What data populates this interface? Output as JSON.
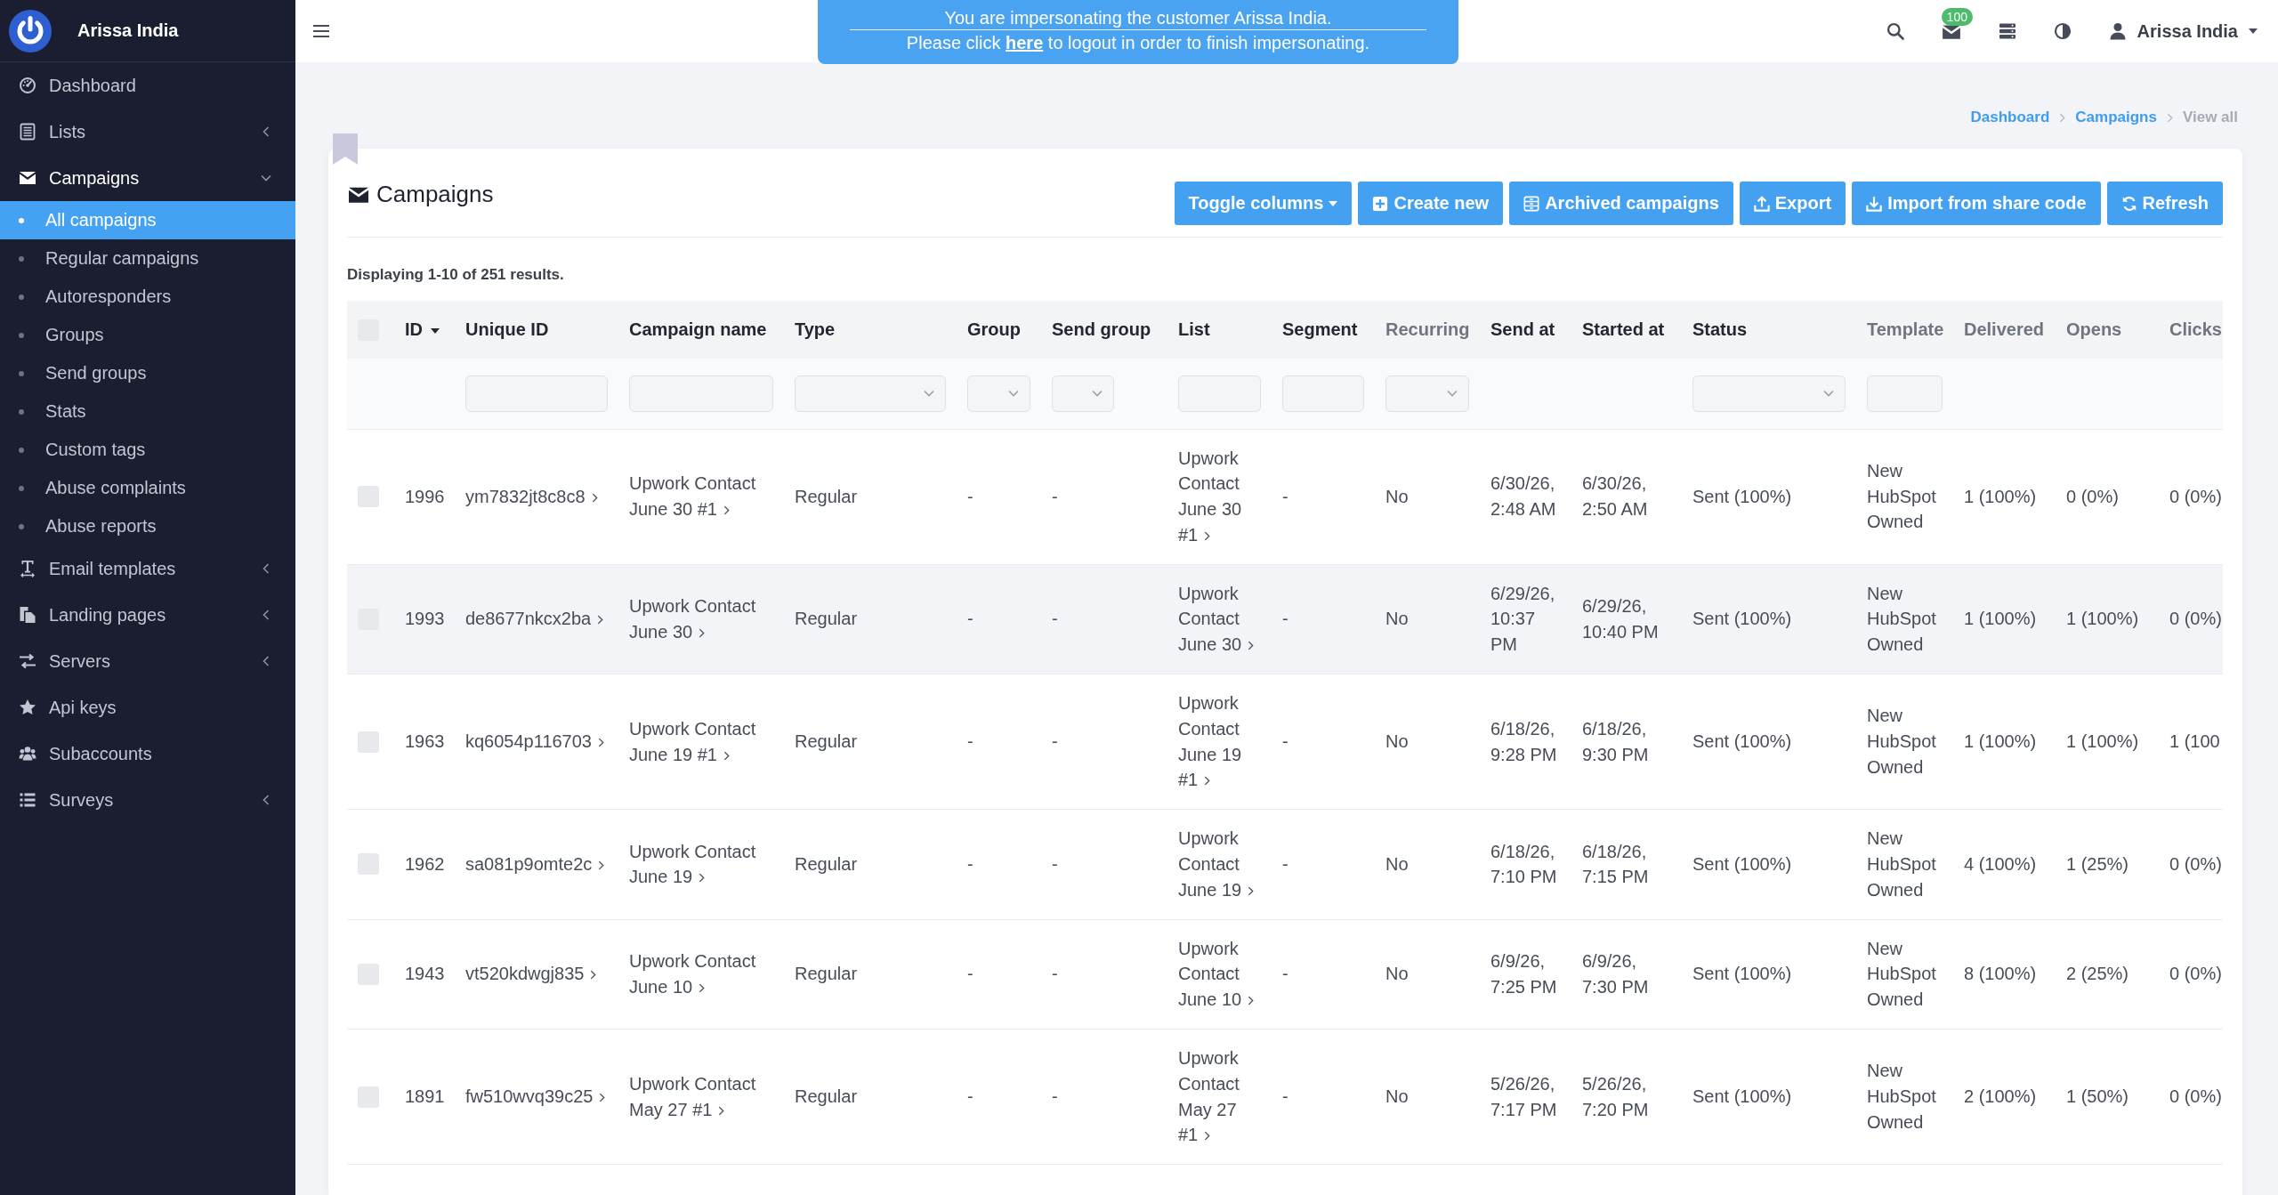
{
  "sidebar": {
    "brand": "Arissa India",
    "items": [
      {
        "kind": "link",
        "label": "Dashboard"
      },
      {
        "kind": "menu",
        "label": "Lists",
        "expanded": false
      },
      {
        "kind": "menu",
        "label": "Campaigns",
        "expanded": true,
        "children": [
          {
            "label": "All campaigns",
            "selected": true
          },
          {
            "label": "Regular campaigns",
            "selected": false
          },
          {
            "label": "Autoresponders",
            "selected": false
          },
          {
            "label": "Groups",
            "selected": false
          },
          {
            "label": "Send groups",
            "selected": false
          },
          {
            "label": "Stats",
            "selected": false
          },
          {
            "label": "Custom tags",
            "selected": false
          },
          {
            "label": "Abuse complaints",
            "selected": false
          },
          {
            "label": "Abuse reports",
            "selected": false
          }
        ]
      },
      {
        "kind": "menu",
        "label": "Email templates",
        "expanded": false
      },
      {
        "kind": "menu",
        "label": "Landing pages",
        "expanded": false
      },
      {
        "kind": "menu",
        "label": "Servers",
        "expanded": false
      },
      {
        "kind": "link",
        "label": "Api keys"
      },
      {
        "kind": "link",
        "label": "Subaccounts"
      },
      {
        "kind": "menu",
        "label": "Surveys",
        "expanded": false
      }
    ]
  },
  "topbar": {
    "impersonation_banner": {
      "line1": "You are impersonating the customer Arissa India.",
      "line2_before": "Please click",
      "link": "here",
      "line2_after": "to logout in order to finish impersonating."
    },
    "notifications_badge": "100",
    "user": "Arissa India"
  },
  "breadcrumb": [
    {
      "kind": "link",
      "label": "Dashboard"
    },
    {
      "kind": "link",
      "label": "Campaigns"
    },
    {
      "kind": "current",
      "label": "View all"
    }
  ],
  "card": {
    "title": "Campaigns",
    "buttons": [
      {
        "kind": "dropdown",
        "label": "Toggle columns"
      },
      {
        "kind": "action",
        "label": "Create new"
      },
      {
        "kind": "action",
        "label": "Archived campaigns"
      },
      {
        "kind": "action",
        "label": "Export"
      },
      {
        "kind": "action",
        "label": "Import from share code"
      },
      {
        "kind": "action",
        "label": "Refresh"
      }
    ],
    "summary": "Displaying 1-10 of 251 results."
  },
  "table": {
    "select_all": {
      "checked": false
    },
    "columns": [
      {
        "kind": "text",
        "label": "ID",
        "sortable": true,
        "sorted": true
      },
      {
        "kind": "link",
        "label": "Unique ID",
        "sortable": true,
        "sorted": false,
        "filter": {
          "kind": "text"
        }
      },
      {
        "kind": "link",
        "label": "Campaign name",
        "sortable": true,
        "sorted": false,
        "filter": {
          "kind": "text"
        }
      },
      {
        "kind": "text",
        "label": "Type",
        "sortable": true,
        "sorted": false,
        "filter": {
          "kind": "select"
        }
      },
      {
        "kind": "text",
        "label": "Group",
        "sortable": true,
        "sorted": false,
        "filter": {
          "kind": "select"
        }
      },
      {
        "kind": "text",
        "label": "Send group",
        "sortable": true,
        "sorted": false,
        "filter": {
          "kind": "select"
        }
      },
      {
        "kind": "link",
        "label": "List",
        "sortable": true,
        "sorted": false,
        "filter": {
          "kind": "text"
        }
      },
      {
        "kind": "text",
        "label": "Segment",
        "sortable": true,
        "sorted": false,
        "filter": {
          "kind": "text"
        }
      },
      {
        "kind": "text",
        "label": "Recurring",
        "sortable": false,
        "sorted": false,
        "filter": {
          "kind": "select"
        }
      },
      {
        "kind": "text",
        "label": "Send at",
        "sortable": true,
        "sorted": false
      },
      {
        "kind": "text",
        "label": "Started at",
        "sortable": true,
        "sorted": false
      },
      {
        "kind": "text",
        "label": "Status",
        "sortable": true,
        "sorted": false,
        "filter": {
          "kind": "select"
        }
      },
      {
        "kind": "text",
        "label": "Template",
        "sortable": false,
        "sorted": false,
        "filter": {
          "kind": "text"
        }
      },
      {
        "kind": "text",
        "label": "Delivered",
        "sortable": false,
        "sorted": false
      },
      {
        "kind": "text",
        "label": "Opens",
        "sortable": false,
        "sorted": false
      },
      {
        "kind": "text",
        "label": "Clicks",
        "sortable": false,
        "sorted": false
      }
    ],
    "rows": [
      {
        "checked": false,
        "hovered": false,
        "cells": [
          "1996",
          "ym7832jt8c8c8",
          "Upwork Contact June 30 #1",
          "Regular",
          "-",
          "-",
          "Upwork Contact June 30 #1",
          "-",
          "No",
          "6/30/26, 2:48 AM",
          "6/30/26, 2:50 AM",
          "Sent (100%)",
          "New HubSpot Owned",
          "1 (100%)",
          "0 (0%)",
          "0 (0%)"
        ]
      },
      {
        "checked": false,
        "hovered": true,
        "cells": [
          "1993",
          "de8677nkcx2ba",
          "Upwork Contact June 30",
          "Regular",
          "-",
          "-",
          "Upwork Contact June 30",
          "-",
          "No",
          "6/29/26, 10:37 PM",
          "6/29/26, 10:40 PM",
          "Sent (100%)",
          "New HubSpot Owned",
          "1 (100%)",
          "1 (100%)",
          "0 (0%)"
        ]
      },
      {
        "checked": false,
        "hovered": false,
        "cells": [
          "1963",
          "kq6054p116703",
          "Upwork Contact June 19 #1",
          "Regular",
          "-",
          "-",
          "Upwork Contact June 19 #1",
          "-",
          "No",
          "6/18/26, 9:28 PM",
          "6/18/26, 9:30 PM",
          "Sent (100%)",
          "New HubSpot Owned",
          "1 (100%)",
          "1 (100%)",
          "1 (100"
        ]
      },
      {
        "checked": false,
        "hovered": false,
        "cells": [
          "1962",
          "sa081p9omte2c",
          "Upwork Contact June 19",
          "Regular",
          "-",
          "-",
          "Upwork Contact June 19",
          "-",
          "No",
          "6/18/26, 7:10 PM",
          "6/18/26, 7:15 PM",
          "Sent (100%)",
          "New HubSpot Owned",
          "4 (100%)",
          "1 (25%)",
          "0 (0%)"
        ]
      },
      {
        "checked": false,
        "hovered": false,
        "cells": [
          "1943",
          "vt520kdwgj835",
          "Upwork Contact June 10",
          "Regular",
          "-",
          "-",
          "Upwork Contact June 10",
          "-",
          "No",
          "6/9/26, 7:25 PM",
          "6/9/26, 7:30 PM",
          "Sent (100%)",
          "New HubSpot Owned",
          "8 (100%)",
          "2 (25%)",
          "0 (0%)"
        ]
      },
      {
        "checked": false,
        "hovered": false,
        "cells": [
          "1891",
          "fw510wvq39c25",
          "Upwork Contact May 27 #1",
          "Regular",
          "-",
          "-",
          "Upwork Contact May 27 #1",
          "-",
          "No",
          "5/26/26, 7:17 PM",
          "5/26/26, 7:20 PM",
          "Sent (100%)",
          "New HubSpot Owned",
          "2 (100%)",
          "1 (50%)",
          "0 (0%)"
        ]
      }
    ]
  }
}
